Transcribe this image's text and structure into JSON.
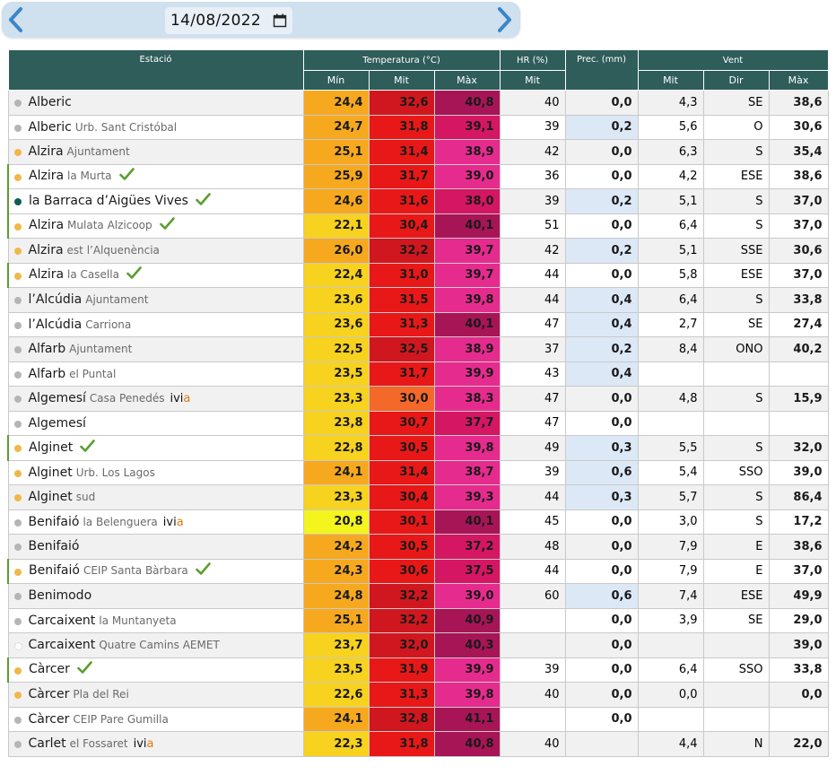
{
  "date": {
    "value": "14/08/2022"
  },
  "icons": {
    "prev": "chevron-left-icon",
    "next": "chevron-right-icon",
    "calendar": "calendar-icon",
    "check": "check-icon"
  },
  "headers": {
    "estacio": "Estació",
    "temperatura": "Temperatura (°C)",
    "hr": "HR (%)",
    "prec": "Prec. (mm)",
    "vent": "Vent",
    "min": "Mín",
    "mit": "Mit",
    "max": "Màx",
    "hr_mit": "Mit",
    "vent_mit": "Mit",
    "vent_dir": "Dir",
    "vent_max": "Màx"
  },
  "colors": {
    "header_bg": "#2f5d5a",
    "dot_gray": "#b5b5b5",
    "dot_orange": "#f0b84a",
    "dot_teal": "#0e5c55",
    "check_green": "#5a9e2f",
    "min_yellow": "#f7d21e",
    "min_bright_yellow": "#f4f41e",
    "min_orange": "#f6a91f",
    "mit_red": "#e81818",
    "mit_dark_red": "#d0171f",
    "mit_orange": "#f4682a",
    "max_pink": "#e62b8e",
    "max_magenta": "#d41663",
    "max_purple": "#a71557",
    "prec_blue": "#dce8f6"
  },
  "stations": [
    {
      "name": "Alberic",
      "sub": "",
      "dot": "gray",
      "check": false,
      "ivia": false,
      "min": "24,4",
      "mit": "32,6",
      "max": "40,8",
      "hr": "40",
      "prec": "0,0",
      "vmit": "4,3",
      "vdir": "SE",
      "vmax": "38,6",
      "minc": "#f6a91f",
      "mitc": "#d0171f",
      "maxc": "#a71557"
    },
    {
      "name": "Alberic",
      "sub": "Urb. Sant Cristóbal",
      "dot": "gray",
      "check": false,
      "ivia": false,
      "min": "24,7",
      "mit": "31,8",
      "max": "39,1",
      "hr": "39",
      "prec": "0,2",
      "vmit": "5,6",
      "vdir": "O",
      "vmax": "30,6",
      "minc": "#f6a91f",
      "mitc": "#e81818",
      "maxc": "#d41663"
    },
    {
      "name": "Alzira",
      "sub": "Ajuntament",
      "dot": "orange",
      "check": false,
      "ivia": false,
      "min": "25,1",
      "mit": "31,4",
      "max": "38,9",
      "hr": "42",
      "prec": "0,0",
      "vmit": "6,3",
      "vdir": "S",
      "vmax": "35,4",
      "minc": "#f6a91f",
      "mitc": "#e81818",
      "maxc": "#e62b8e"
    },
    {
      "name": "Alzira",
      "sub": "la Murta",
      "dot": "orange",
      "check": true,
      "ivia": false,
      "min": "25,9",
      "mit": "31,7",
      "max": "39,0",
      "hr": "36",
      "prec": "0,0",
      "vmit": "4,2",
      "vdir": "ESE",
      "vmax": "38,6",
      "minc": "#f6a91f",
      "mitc": "#e81818",
      "maxc": "#e62b8e"
    },
    {
      "name": "la Barraca d’Aigües Vives",
      "sub": "",
      "dot": "teal",
      "check": true,
      "ivia": false,
      "min": "24,6",
      "mit": "31,6",
      "max": "38,0",
      "hr": "39",
      "prec": "0,2",
      "vmit": "5,1",
      "vdir": "S",
      "vmax": "37,0",
      "minc": "#f6a91f",
      "mitc": "#e81818",
      "maxc": "#d41663"
    },
    {
      "name": "Alzira",
      "sub": "Mulata Alzicoop",
      "dot": "orange",
      "check": true,
      "ivia": false,
      "min": "22,1",
      "mit": "30,4",
      "max": "40,1",
      "hr": "51",
      "prec": "0,0",
      "vmit": "6,4",
      "vdir": "S",
      "vmax": "37,0",
      "minc": "#f7d21e",
      "mitc": "#e81818",
      "maxc": "#a71557"
    },
    {
      "name": "Alzira",
      "sub": "est l’Alquenència",
      "dot": "orange",
      "check": false,
      "ivia": false,
      "min": "26,0",
      "mit": "32,2",
      "max": "39,7",
      "hr": "42",
      "prec": "0,2",
      "vmit": "5,1",
      "vdir": "SSE",
      "vmax": "30,6",
      "minc": "#f6a91f",
      "mitc": "#d0171f",
      "maxc": "#e62b8e"
    },
    {
      "name": "Alzira",
      "sub": "la Casella",
      "dot": "orange",
      "check": true,
      "ivia": false,
      "min": "22,4",
      "mit": "31,0",
      "max": "39,7",
      "hr": "44",
      "prec": "0,0",
      "vmit": "5,8",
      "vdir": "ESE",
      "vmax": "37,0",
      "minc": "#f7d21e",
      "mitc": "#e81818",
      "maxc": "#e62b8e"
    },
    {
      "name": "l’Alcúdia",
      "sub": "Ajuntament",
      "dot": "gray",
      "check": false,
      "ivia": false,
      "min": "23,6",
      "mit": "31,5",
      "max": "39,8",
      "hr": "44",
      "prec": "0,4",
      "vmit": "6,4",
      "vdir": "S",
      "vmax": "33,8",
      "minc": "#f7d21e",
      "mitc": "#e81818",
      "maxc": "#e62b8e"
    },
    {
      "name": "l’Alcúdia",
      "sub": "Carriona",
      "dot": "gray",
      "check": false,
      "ivia": false,
      "min": "23,6",
      "mit": "31,3",
      "max": "40,1",
      "hr": "47",
      "prec": "0,4",
      "vmit": "2,7",
      "vdir": "SE",
      "vmax": "27,4",
      "minc": "#f7d21e",
      "mitc": "#e81818",
      "maxc": "#a71557"
    },
    {
      "name": "Alfarb",
      "sub": "Ajuntament",
      "dot": "gray",
      "check": false,
      "ivia": false,
      "min": "22,5",
      "mit": "32,5",
      "max": "38,9",
      "hr": "37",
      "prec": "0,2",
      "vmit": "8,4",
      "vdir": "ONO",
      "vmax": "40,2",
      "minc": "#f7d21e",
      "mitc": "#d0171f",
      "maxc": "#e62b8e"
    },
    {
      "name": "Alfarb",
      "sub": "el Puntal",
      "dot": "gray",
      "check": false,
      "ivia": false,
      "min": "23,5",
      "mit": "31,7",
      "max": "39,9",
      "hr": "43",
      "prec": "0,4",
      "vmit": "",
      "vdir": "",
      "vmax": "",
      "minc": "#f7d21e",
      "mitc": "#e81818",
      "maxc": "#e62b8e"
    },
    {
      "name": "Algemesí",
      "sub": "Casa Penedés",
      "dot": "gray",
      "check": false,
      "ivia": true,
      "min": "23,3",
      "mit": "30,0",
      "max": "38,3",
      "hr": "47",
      "prec": "0,0",
      "vmit": "4,8",
      "vdir": "S",
      "vmax": "15,9",
      "minc": "#f7d21e",
      "mitc": "#f4682a",
      "maxc": "#e62b8e"
    },
    {
      "name": "Algemesí",
      "sub": "",
      "dot": "gray",
      "check": false,
      "ivia": false,
      "min": "23,8",
      "mit": "30,7",
      "max": "37,7",
      "hr": "47",
      "prec": "0,0",
      "vmit": "",
      "vdir": "",
      "vmax": "",
      "minc": "#f7d21e",
      "mitc": "#e81818",
      "maxc": "#d41663"
    },
    {
      "name": "Alginet",
      "sub": "",
      "dot": "orange",
      "check": true,
      "ivia": false,
      "min": "22,8",
      "mit": "30,5",
      "max": "39,8",
      "hr": "49",
      "prec": "0,3",
      "vmit": "5,5",
      "vdir": "S",
      "vmax": "32,0",
      "minc": "#f7d21e",
      "mitc": "#e81818",
      "maxc": "#e62b8e"
    },
    {
      "name": "Alginet",
      "sub": "Urb. Los Lagos",
      "dot": "orange",
      "check": false,
      "ivia": false,
      "min": "24,1",
      "mit": "31,4",
      "max": "38,7",
      "hr": "39",
      "prec": "0,6",
      "vmit": "5,4",
      "vdir": "SSO",
      "vmax": "39,0",
      "minc": "#f6a91f",
      "mitc": "#e81818",
      "maxc": "#e62b8e"
    },
    {
      "name": "Alginet",
      "sub": "sud",
      "dot": "orange",
      "check": false,
      "ivia": false,
      "min": "23,3",
      "mit": "30,4",
      "max": "39,3",
      "hr": "44",
      "prec": "0,3",
      "vmit": "5,7",
      "vdir": "S",
      "vmax": "86,4",
      "minc": "#f7d21e",
      "mitc": "#e81818",
      "maxc": "#e62b8e"
    },
    {
      "name": "Benifaió",
      "sub": "la Belenguera",
      "dot": "gray",
      "check": false,
      "ivia": true,
      "min": "20,8",
      "mit": "30,1",
      "max": "40,1",
      "hr": "45",
      "prec": "0,0",
      "vmit": "3,0",
      "vdir": "S",
      "vmax": "17,2",
      "minc": "#f4f41e",
      "mitc": "#e81818",
      "maxc": "#a71557"
    },
    {
      "name": "Benifaió",
      "sub": "",
      "dot": "gray",
      "check": false,
      "ivia": false,
      "min": "24,2",
      "mit": "30,5",
      "max": "37,2",
      "hr": "48",
      "prec": "0,0",
      "vmit": "7,9",
      "vdir": "E",
      "vmax": "38,6",
      "minc": "#f6a91f",
      "mitc": "#e81818",
      "maxc": "#d41663"
    },
    {
      "name": "Benifaió",
      "sub": "CEIP Santa Bàrbara",
      "dot": "orange",
      "check": true,
      "ivia": false,
      "min": "24,3",
      "mit": "30,6",
      "max": "37,5",
      "hr": "44",
      "prec": "0,0",
      "vmit": "7,9",
      "vdir": "E",
      "vmax": "37,0",
      "minc": "#f6a91f",
      "mitc": "#e81818",
      "maxc": "#d41663"
    },
    {
      "name": "Benimodo",
      "sub": "",
      "dot": "gray",
      "check": false,
      "ivia": false,
      "min": "24,8",
      "mit": "32,2",
      "max": "39,0",
      "hr": "60",
      "prec": "0,6",
      "vmit": "7,4",
      "vdir": "ESE",
      "vmax": "49,9",
      "minc": "#f6a91f",
      "mitc": "#d0171f",
      "maxc": "#e62b8e"
    },
    {
      "name": "Carcaixent",
      "sub": "la Muntanyeta",
      "dot": "gray",
      "check": false,
      "ivia": false,
      "min": "25,1",
      "mit": "32,2",
      "max": "40,9",
      "hr": "",
      "prec": "0,0",
      "vmit": "3,9",
      "vdir": "SE",
      "vmax": "29,0",
      "minc": "#f6a91f",
      "mitc": "#d0171f",
      "maxc": "#a71557"
    },
    {
      "name": "Carcaixent",
      "sub": "Quatre Camins AEMET",
      "dot": "outline",
      "check": false,
      "ivia": false,
      "min": "23,7",
      "mit": "32,0",
      "max": "40,3",
      "hr": "",
      "prec": "0,0",
      "vmit": "",
      "vdir": "",
      "vmax": "39,0",
      "minc": "#f7d21e",
      "mitc": "#d0171f",
      "maxc": "#a71557"
    },
    {
      "name": "Càrcer",
      "sub": "",
      "dot": "orange",
      "check": true,
      "ivia": false,
      "min": "23,5",
      "mit": "31,9",
      "max": "39,9",
      "hr": "39",
      "prec": "0,0",
      "vmit": "6,4",
      "vdir": "SSO",
      "vmax": "33,8",
      "minc": "#f7d21e",
      "mitc": "#e81818",
      "maxc": "#e62b8e"
    },
    {
      "name": "Càrcer",
      "sub": "Pla del Rei",
      "dot": "orange",
      "check": false,
      "ivia": false,
      "min": "22,6",
      "mit": "31,3",
      "max": "39,8",
      "hr": "40",
      "prec": "0,0",
      "vmit": "0,0",
      "vdir": "",
      "vmax": "0,0",
      "minc": "#f7d21e",
      "mitc": "#e81818",
      "maxc": "#e62b8e"
    },
    {
      "name": "Càrcer",
      "sub": "CEIP Pare Gumilla",
      "dot": "gray",
      "check": false,
      "ivia": false,
      "min": "24,1",
      "mit": "32,8",
      "max": "41,1",
      "hr": "",
      "prec": "0,0",
      "vmit": "",
      "vdir": "",
      "vmax": "",
      "minc": "#f6a91f",
      "mitc": "#d0171f",
      "maxc": "#a71557"
    },
    {
      "name": "Carlet",
      "sub": "el Fossaret",
      "dot": "gray",
      "check": false,
      "ivia": true,
      "min": "22,3",
      "mit": "31,8",
      "max": "40,8",
      "hr": "40",
      "prec": "",
      "vmit": "4,4",
      "vdir": "N",
      "vmax": "22,0",
      "minc": "#f7d21e",
      "mitc": "#e81818",
      "maxc": "#a71557"
    }
  ]
}
